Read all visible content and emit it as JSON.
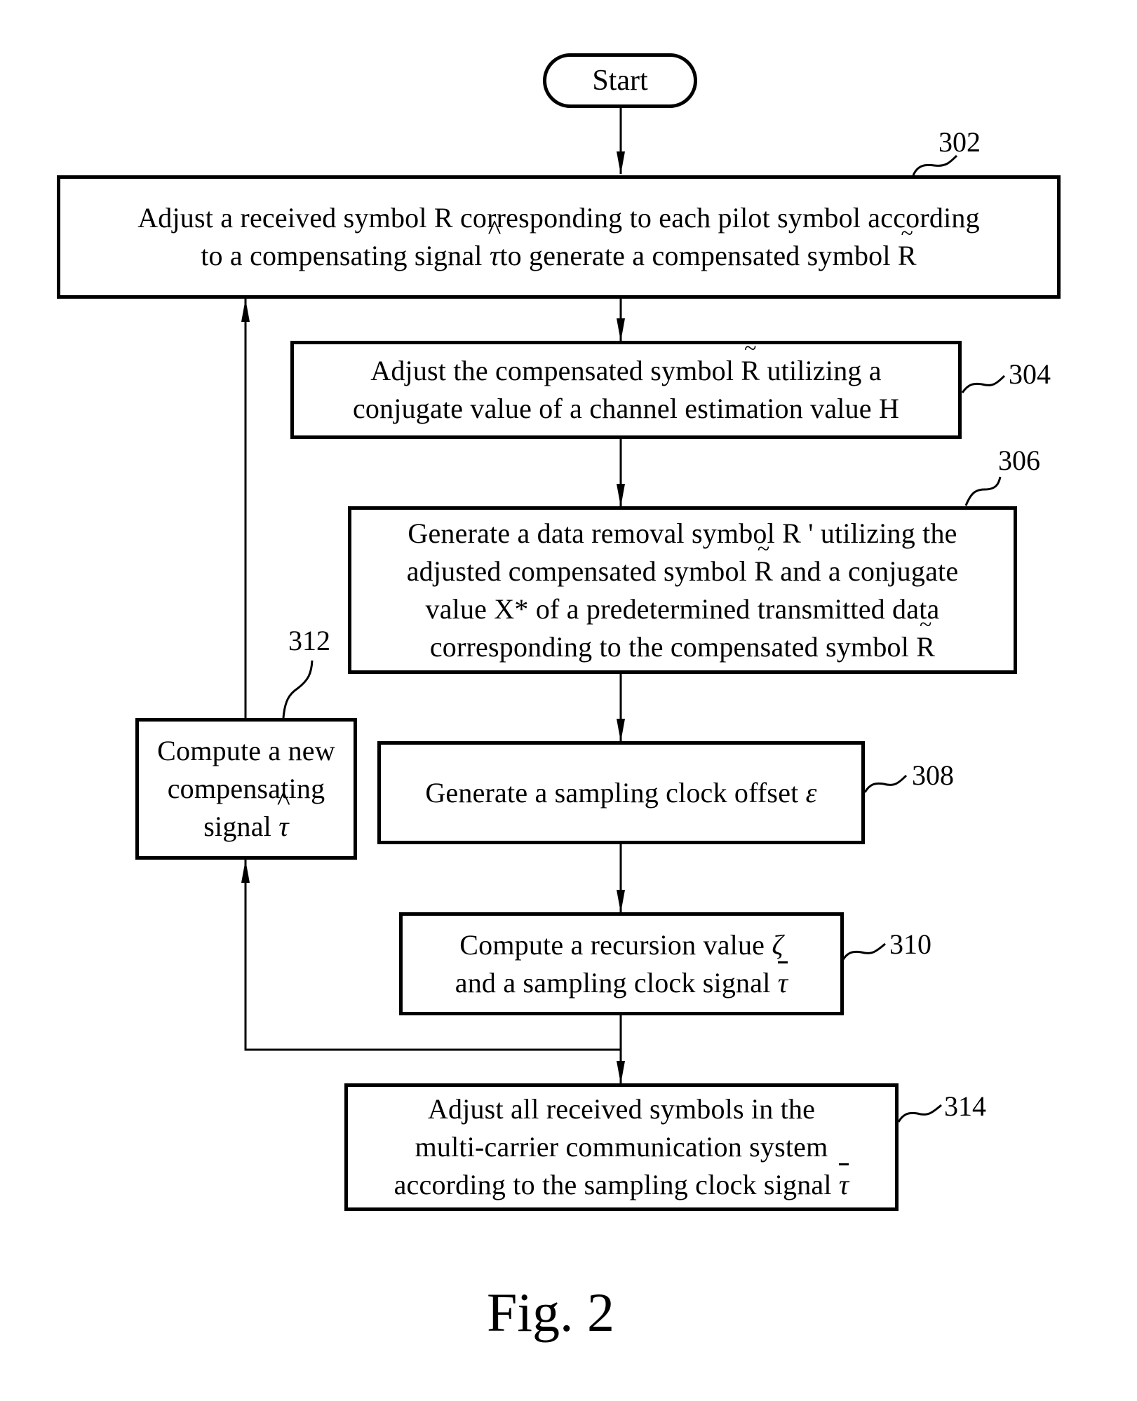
{
  "figure": {
    "caption": "Fig. 2",
    "start": {
      "label": "Start"
    },
    "steps": [
      {
        "id": "302",
        "ref": "302",
        "lines": [
          [
            "Adjust a received symbol R corresponding to each pilot symbol according"
          ],
          [
            "to a compensating signal ",
            {
              "sym": "τ",
              "accent": "hat"
            },
            "to generate a compensated symbol ",
            {
              "sym": "R",
              "accent": "tilde",
              "upright": true
            }
          ]
        ]
      },
      {
        "id": "304",
        "ref": "304",
        "lines": [
          [
            "Adjust the compensated symbol ",
            {
              "sym": "R",
              "accent": "tilde",
              "upright": true
            },
            " utilizing a"
          ],
          [
            "conjugate value of a channel estimation value H"
          ]
        ]
      },
      {
        "id": "306",
        "ref": "306",
        "lines": [
          [
            "Generate a data removal symbol R ' utilizing the"
          ],
          [
            "adjusted compensated symbol ",
            {
              "sym": "R",
              "accent": "tilde",
              "upright": true
            },
            " and a conjugate"
          ],
          [
            "value X* of a predetermined transmitted data"
          ],
          [
            "corresponding to the compensated symbol ",
            {
              "sym": "R",
              "accent": "tilde",
              "upright": true
            }
          ]
        ]
      },
      {
        "id": "308",
        "ref": "308",
        "lines": [
          [
            "Generate a sampling clock offset  ",
            {
              "sym": "ε",
              "accent": ""
            }
          ]
        ]
      },
      {
        "id": "310",
        "ref": "310",
        "lines": [
          [
            "Compute a recursion value  ",
            {
              "sym": "ζ",
              "accent": ""
            }
          ],
          [
            "and a sampling clock signal  ",
            {
              "sym": "τ",
              "accent": "bar"
            }
          ]
        ]
      },
      {
        "id": "312",
        "ref": "312",
        "lines": [
          [
            "Compute a new"
          ],
          [
            "compensating"
          ],
          [
            "signal ",
            {
              "sym": "τ",
              "accent": "hat"
            }
          ]
        ]
      },
      {
        "id": "314",
        "ref": "314",
        "lines": [
          [
            "Adjust all received symbols in the"
          ],
          [
            "multi-carrier communication system"
          ],
          [
            "according to the sampling clock signal  ",
            {
              "sym": "τ",
              "accent": "bar"
            }
          ]
        ]
      }
    ],
    "edges": [
      {
        "from": "start",
        "to": "302"
      },
      {
        "from": "302",
        "to": "304"
      },
      {
        "from": "304",
        "to": "306"
      },
      {
        "from": "306",
        "to": "308"
      },
      {
        "from": "308",
        "to": "310"
      },
      {
        "from": "310",
        "to": "314"
      },
      {
        "from": "310",
        "to": "312"
      },
      {
        "from": "312",
        "to": "302"
      }
    ]
  }
}
